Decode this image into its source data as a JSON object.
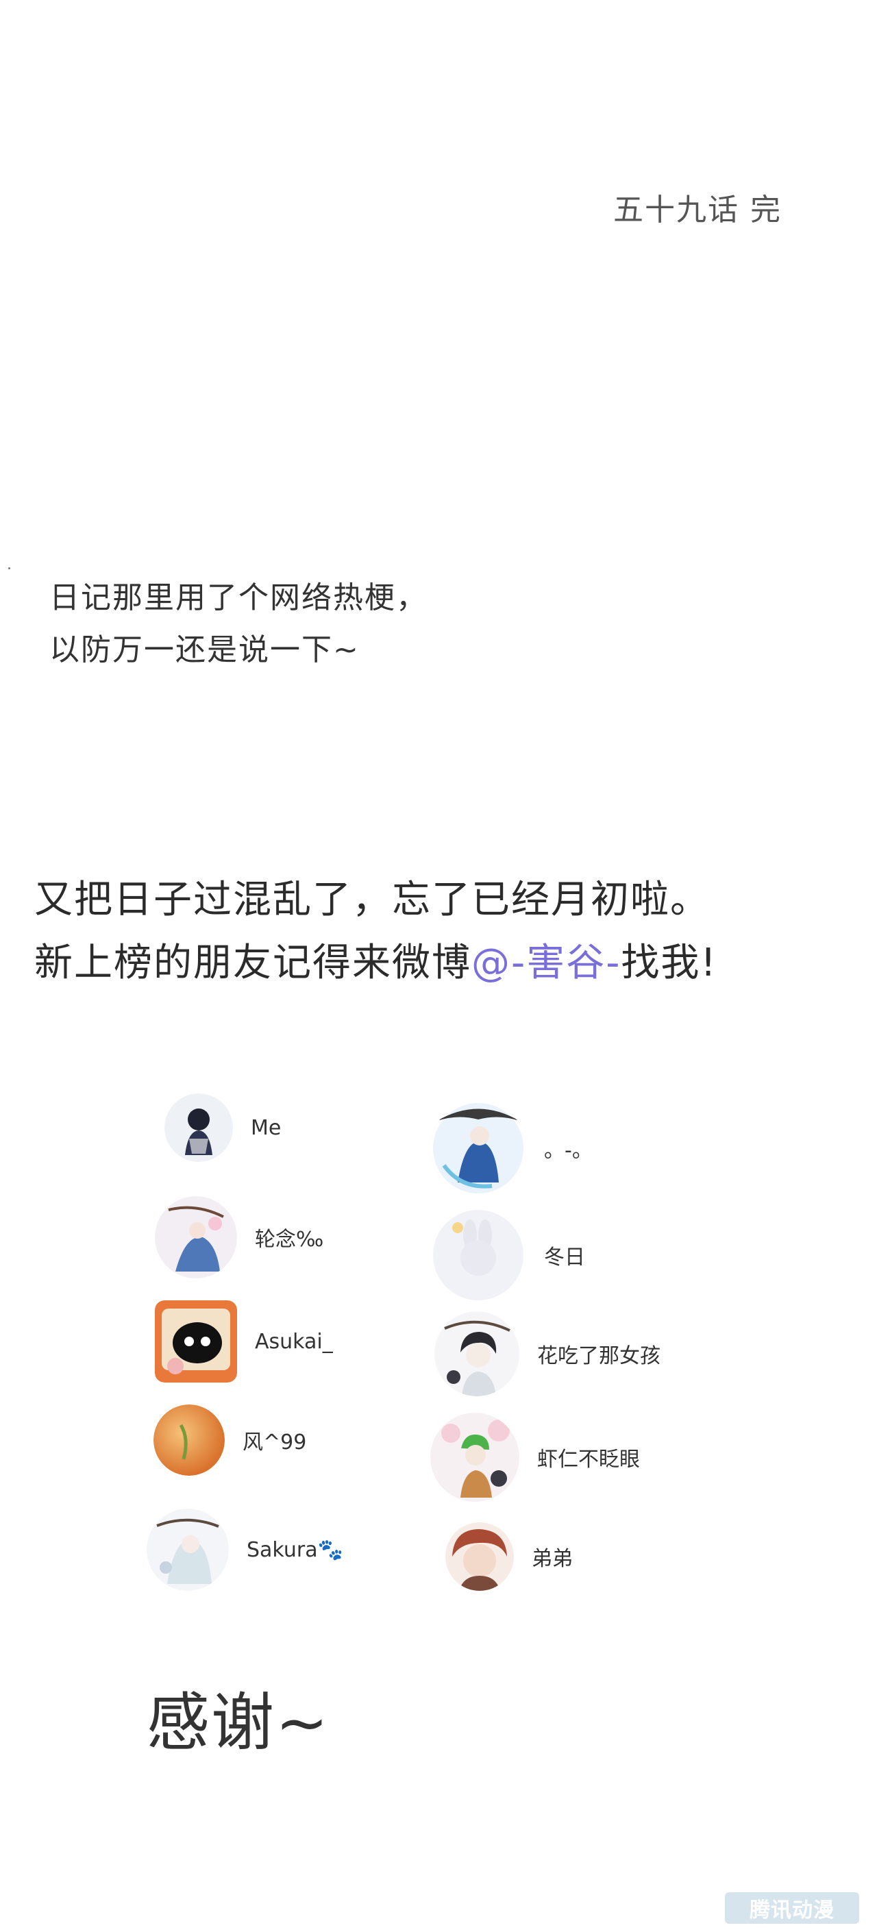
{
  "chapter_end": "五十九话 完",
  "note": {
    "line1": "日记那里用了个网络热梗，",
    "line2": "以防万一还是说一下~"
  },
  "message": {
    "line1": "又把日子过混乱了，忘了已经月初啦。",
    "line2_before": "新上榜的朋友记得来微博",
    "line2_mention": "@-害谷-",
    "line2_after": "找我!"
  },
  "colors": {
    "mention": "#7a6fd8",
    "text": "#333333",
    "watermark_bg": "#cfe0ea"
  },
  "friends": [
    {
      "name": "Me",
      "avatar": "dark-haired-character-avatar"
    },
    {
      "name": "。-。",
      "avatar": "blue-robed-character-avatar"
    },
    {
      "name": "轮念‰",
      "avatar": "blue-dress-character-avatar"
    },
    {
      "name": "冬日",
      "avatar": "moon-bunny-avatar"
    },
    {
      "name": "Asukai_",
      "avatar": "black-cat-avatar"
    },
    {
      "name": "花吃了那女孩",
      "avatar": "dark-haired-boy-avatar"
    },
    {
      "name": "风^99",
      "avatar": "orange-peach-avatar"
    },
    {
      "name": "虾仁不眨眼",
      "avatar": "green-haired-character-avatar"
    },
    {
      "name": "Sakura🐾",
      "avatar": "white-haired-character-avatar"
    },
    {
      "name": "弟弟",
      "avatar": "red-haired-boy-avatar"
    }
  ],
  "thanks": "感谢~",
  "watermark": "腾讯动漫"
}
